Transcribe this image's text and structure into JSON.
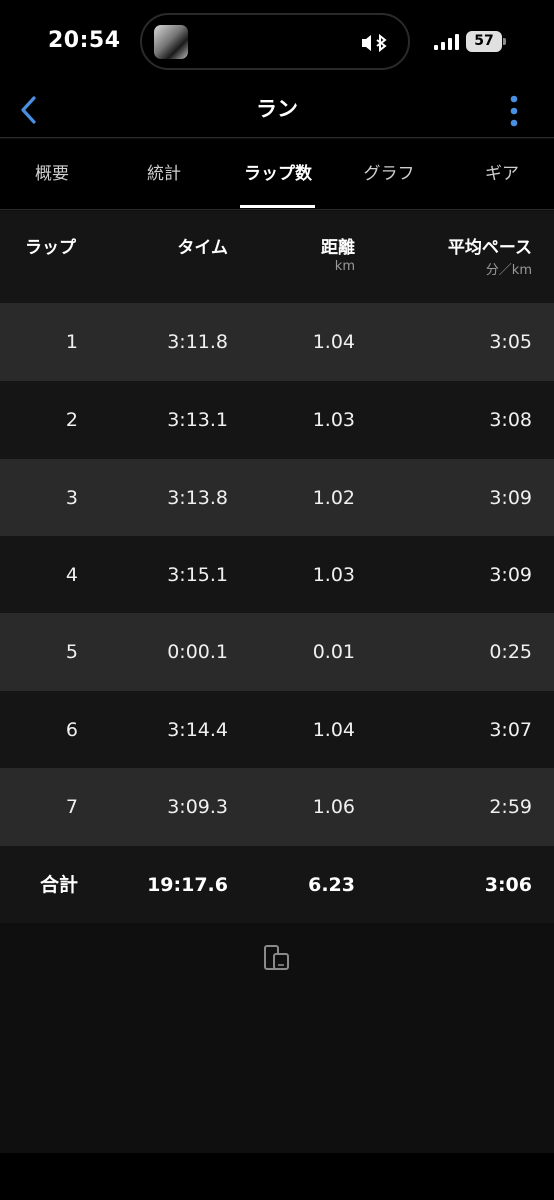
{
  "status_bar": {
    "time": "20:54",
    "battery": "57",
    "icons": [
      "now-playing-thumbnail-icon",
      "bluetooth-icon",
      "cellular-signal-icon",
      "battery-icon"
    ]
  },
  "nav": {
    "title": "ラン",
    "back_icon": "chevron-left-icon",
    "more_icon": "vertical-dots-icon",
    "accent_color": "#4a90e2"
  },
  "tabs": [
    {
      "label": "概要",
      "active": false
    },
    {
      "label": "統計",
      "active": false
    },
    {
      "label": "ラップ数",
      "active": true
    },
    {
      "label": "グラフ",
      "active": false
    },
    {
      "label": "ギア",
      "active": false
    }
  ],
  "table": {
    "columns": [
      {
        "label": "ラップ",
        "unit": ""
      },
      {
        "label": "タイム",
        "unit": ""
      },
      {
        "label": "距離",
        "unit": "km"
      },
      {
        "label": "平均ペース",
        "unit": "分／km"
      }
    ],
    "rows": [
      {
        "lap": "1",
        "time": "3:11.8",
        "distance": "1.04",
        "pace": "3:05"
      },
      {
        "lap": "2",
        "time": "3:13.1",
        "distance": "1.03",
        "pace": "3:08"
      },
      {
        "lap": "3",
        "time": "3:13.8",
        "distance": "1.02",
        "pace": "3:09"
      },
      {
        "lap": "4",
        "time": "3:15.1",
        "distance": "1.03",
        "pace": "3:09"
      },
      {
        "lap": "5",
        "time": "0:00.1",
        "distance": "0.01",
        "pace": "0:25"
      },
      {
        "lap": "6",
        "time": "3:14.4",
        "distance": "1.04",
        "pace": "3:07"
      },
      {
        "lap": "7",
        "time": "3:09.3",
        "distance": "1.06",
        "pace": "2:59"
      }
    ],
    "total": {
      "label": "合計",
      "time": "19:17.6",
      "distance": "6.23",
      "pace": "3:06"
    }
  },
  "footer": {
    "icon": "device-sync-icon"
  }
}
